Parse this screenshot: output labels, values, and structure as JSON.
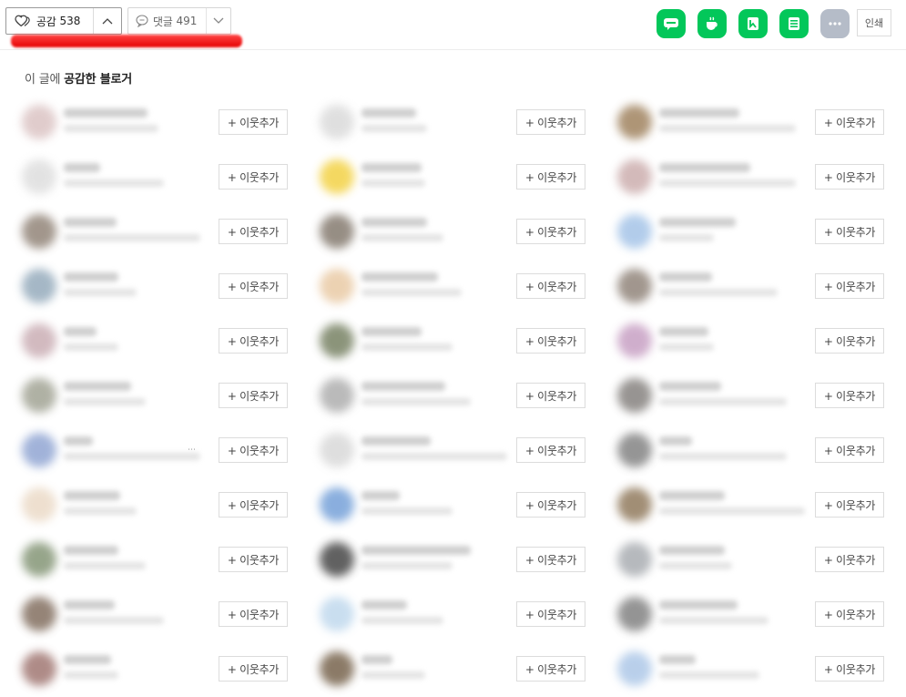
{
  "toolbar": {
    "like": {
      "label": "공감",
      "count": "538"
    },
    "comment": {
      "label": "댓글",
      "count": "491"
    },
    "share_icons": [
      {
        "name": "blog-share-icon",
        "color": "#03c75a"
      },
      {
        "name": "cafe-share-icon",
        "color": "#03c75a"
      },
      {
        "name": "keep-share-icon",
        "color": "#03c75a"
      },
      {
        "name": "memo-share-icon",
        "color": "#03c75a"
      },
      {
        "name": "more-share-icon",
        "color": "#b5bcc8"
      }
    ],
    "print_label": "인쇄"
  },
  "section": {
    "title_prefix": "이 글에 ",
    "title_bold": "공감한 블로거"
  },
  "add_neighbor_label": "+ 이웃추가",
  "colors": {
    "accent": "#03c75a",
    "redaction": "#e60000"
  },
  "blogger_avatar_colors": [
    [
      "#d9c0c0",
      "#d8d8d8",
      "#9a7b55"
    ],
    [
      "#dcdcdc",
      "#f2cf3a",
      "#c9a9a9"
    ],
    [
      "#8b7d70",
      "#7d7266",
      "#9fc0e6"
    ],
    [
      "#8fa6b8",
      "#e8c7a0",
      "#8a7d72"
    ],
    [
      "#c7a9b0",
      "#6f7a5a",
      "#c49ac0"
    ],
    [
      "#9c9e8e",
      "#a9a9a9",
      "#7e7a77"
    ],
    [
      "#8aa0d0",
      "#d6d6d6",
      "#7b7b7b"
    ],
    [
      "#ead8c4",
      "#6d9bd6",
      "#8a7253"
    ],
    [
      "#7d8f6e",
      "#3a3a3a",
      "#a4a8ad"
    ],
    [
      "#7b6656",
      "#bcd6ec",
      "#7a7a7a"
    ],
    [
      "#9b6f6a",
      "#6f5a42",
      "#a8c4e6"
    ]
  ]
}
